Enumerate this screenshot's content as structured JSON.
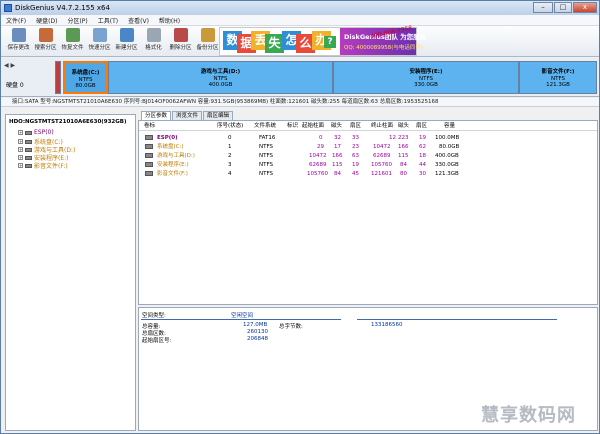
{
  "window": {
    "title": "DiskGenius V4.7.2.155 x64",
    "btn_min": "–",
    "btn_max": "□",
    "btn_close": "x"
  },
  "menu": [
    "文件(F)",
    "硬盘(D)",
    "分区(P)",
    "工具(T)",
    "查看(V)",
    "帮助(H)"
  ],
  "toolbar": {
    "items": [
      {
        "label": "保存更改",
        "icon": "save-icon",
        "color": "#6a8fbf"
      },
      {
        "label": "搜索分区",
        "icon": "search-icon",
        "color": "#c56a3a"
      },
      {
        "label": "恢复文件",
        "icon": "recover-icon",
        "color": "#5b9a55"
      },
      {
        "label": "快速分区",
        "icon": "quick-partition-icon",
        "color": "#7aa3d1"
      },
      {
        "label": "新建分区",
        "icon": "new-partition-icon",
        "color": "#4b86c9"
      },
      {
        "label": "格式化",
        "icon": "format-icon",
        "color": "#9aa6b3"
      },
      {
        "label": "删除分区",
        "icon": "delete-partition-icon",
        "color": "#b84a4a"
      },
      {
        "label": "备份分区",
        "icon": "backup-icon",
        "color": "#c89a3a"
      }
    ]
  },
  "banner": {
    "chars": [
      "数",
      "据",
      "丢",
      "失",
      "怎",
      "么",
      "办",
      "?"
    ],
    "line1": "DiskGenius团队 为您服务",
    "line2": "QQ: 4000089958(与电话同号)",
    "annotation": "400-008-9958"
  },
  "diskmap": {
    "nav": "◀ ▶",
    "disk_label": "硬盘 0",
    "segments": [
      {
        "name": "",
        "fs": "",
        "size": "",
        "color": "#c43b3b"
      },
      {
        "name": "系统盘(C:)",
        "fs": "NTFS",
        "size": "80.0GB",
        "color": "#4ea8e8"
      },
      {
        "name": "游戏与工具(D:)",
        "fs": "NTFS",
        "size": "400.0GB",
        "color": "#5cb3ef"
      },
      {
        "name": "安装程序(E:)",
        "fs": "NTFS",
        "size": "330.0GB",
        "color": "#5cb3ef"
      },
      {
        "name": "影音文件(F:)",
        "fs": "NTFS",
        "size": "121.3GB",
        "color": "#5cb3ef"
      }
    ]
  },
  "infobar": "接口:SATA 型号:NGSTMTST21010A6E630 序列号:BJ014OF0062AFWN 容量:931.5GB(953869MB) 柱面数:121601 磁头数:255 每道扇区数:63 总扇区数:1953525168",
  "tree": {
    "root": "HDO:NGSTMTST21010A6E630(932GB)",
    "nodes": [
      {
        "label": "ESP(0)",
        "color": "#7a007a"
      },
      {
        "label": "系统盘(C:)",
        "color": "#c07a00"
      },
      {
        "label": "游戏与工具(D:)",
        "color": "#c07a00"
      },
      {
        "label": "安装程序(E:)",
        "color": "#c07a00"
      },
      {
        "label": "影音文件(F:)",
        "color": "#c07a00"
      }
    ]
  },
  "tabs": [
    "分区参数",
    "浏览文件",
    "扇区编辑"
  ],
  "table": {
    "headers": [
      "卷标",
      "序号(状态)",
      "文件系统",
      "标识",
      "起始柱面",
      "磁头",
      "扇区",
      "终止柱面",
      "磁头",
      "扇区",
      "容量"
    ],
    "rows": [
      {
        "label": "ESP(0)",
        "idx": "0",
        "fs": "FAT16",
        "id": "",
        "sc": "0",
        "sh": "32",
        "ss": "33",
        "ec": "12",
        "eh": "223",
        "es": "19",
        "cap": "100.0MB",
        "color": "#7a007a"
      },
      {
        "label": "系统盘(C:)",
        "idx": "1",
        "fs": "NTFS",
        "id": "",
        "sc": "29",
        "sh": "17",
        "ss": "23",
        "ec": "10472",
        "eh": "166",
        "es": "62",
        "cap": "80.0GB",
        "color": "#c07a00"
      },
      {
        "label": "游戏与工具(D:)",
        "idx": "2",
        "fs": "NTFS",
        "id": "",
        "sc": "10472",
        "sh": "166",
        "ss": "63",
        "ec": "62689",
        "eh": "115",
        "es": "18",
        "cap": "400.0GB",
        "color": "#c07a00"
      },
      {
        "label": "安装程序(E:)",
        "idx": "3",
        "fs": "NTFS",
        "id": "",
        "sc": "62689",
        "sh": "115",
        "ss": "19",
        "ec": "105760",
        "eh": "84",
        "es": "44",
        "cap": "330.0GB",
        "color": "#c07a00"
      },
      {
        "label": "影音文件(F:)",
        "idx": "4",
        "fs": "NTFS",
        "id": "",
        "sc": "105760",
        "sh": "84",
        "ss": "45",
        "ec": "121601",
        "eh": "80",
        "es": "30",
        "cap": "121.3GB",
        "color": "#c07a00"
      }
    ]
  },
  "details": {
    "space_type_label": "空间类型:",
    "space_type_value": "空闲空间",
    "capacity_label": "总容量:",
    "capacity_value": "127.0MB",
    "total_bytes_label": "总字节数:",
    "total_bytes_value": "133186560",
    "sectors_label": "总扇区数:",
    "sectors_value": "260130",
    "start_sector_label": "起始扇区号:",
    "start_sector_value": "206848"
  },
  "watermark": "慧享数码网"
}
